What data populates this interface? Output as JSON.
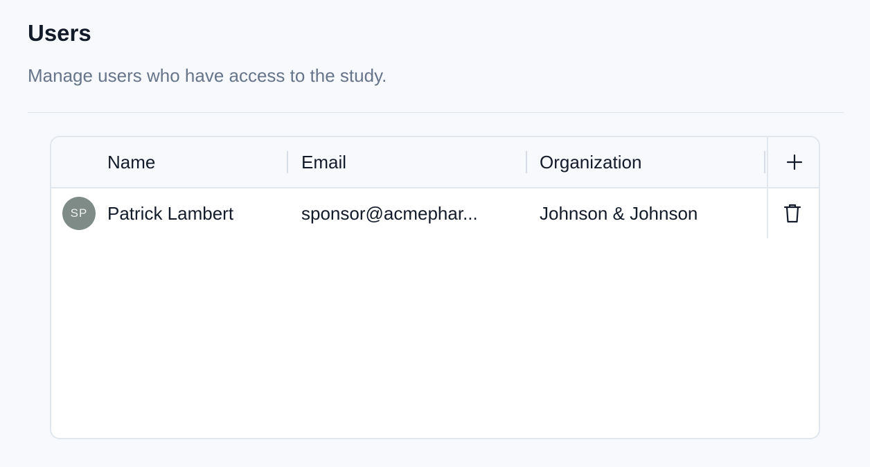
{
  "header": {
    "title": "Users",
    "subtitle": "Manage users who have access to the study."
  },
  "table": {
    "columns": [
      "Name",
      "Email",
      "Organization"
    ],
    "add_icon": "plus-icon",
    "delete_icon": "trash-icon",
    "rows": [
      {
        "initials": "SP",
        "name": "Patrick Lambert",
        "email": "sponsor@acmephar...",
        "organization": "Johnson & Johnson"
      }
    ]
  },
  "colors": {
    "background": "#f7f9fc",
    "text": "#131a29",
    "muted_text": "#66758a",
    "avatar": "#7f8b86",
    "border": "#e2e7ee"
  }
}
